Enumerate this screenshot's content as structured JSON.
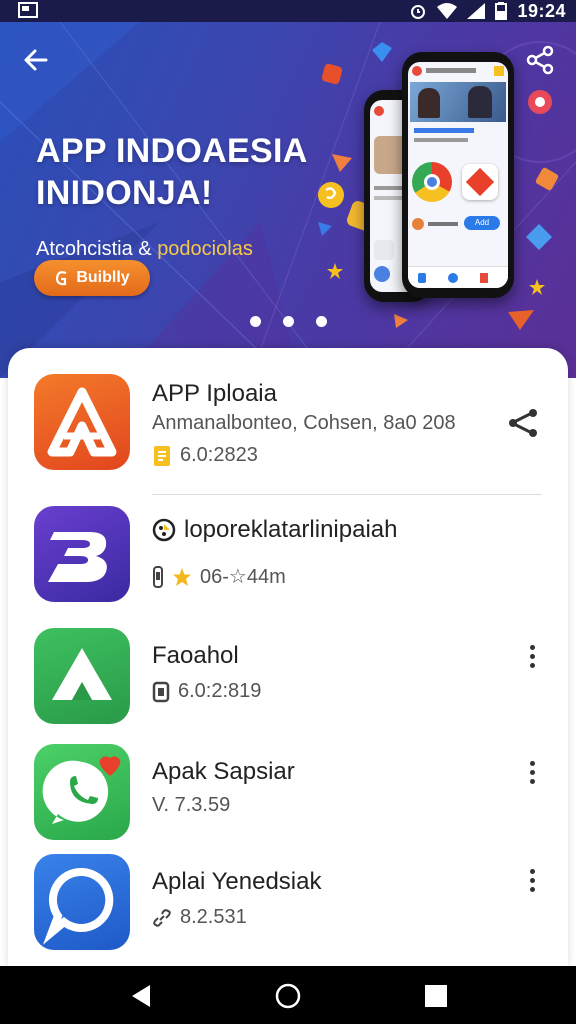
{
  "status_bar": {
    "time": "19:24",
    "icons": [
      "alarm-icon",
      "wifi-icon",
      "cellular-icon",
      "battery-icon"
    ]
  },
  "hero": {
    "title_line1": "APP INDOAESIA",
    "title_line2": "INIDONJA!",
    "subtitle_a": "Atcohcistia",
    "subtitle_amp": "&",
    "subtitle_b": "podociolas",
    "cta_label": "Buiblly",
    "dots": 3,
    "phone_button": "Add"
  },
  "apps": [
    {
      "name": "APP Iploaia",
      "meta": "Anmanalbonteo, Cohsen, 8a0 208",
      "version": "6.0:2823",
      "icon_color": "#ec5a24",
      "action": "share"
    },
    {
      "name": "loporeklatarlinipaiah",
      "meta": "06-☆44m",
      "version": "",
      "icon_color": "#4a3ab0",
      "action": "none"
    },
    {
      "name": "Faoahol",
      "meta": "",
      "version": "6.0:2:819",
      "icon_color": "#34a853",
      "action": "more"
    },
    {
      "name": "Apak Sapsiar",
      "meta": "",
      "version": "V. 7.3.59",
      "icon_color": "#3cbc5c",
      "action": "more"
    },
    {
      "name": "Aplai Yenedsiak",
      "meta": "",
      "version": "8.2.531",
      "icon_color": "#2a6ee0",
      "action": "more"
    }
  ],
  "colors": {
    "status_bar": "#1a1b4a",
    "hero_start": "#2a4fb8",
    "hero_end": "#5a2f96",
    "accent_orange": "#f0842a",
    "nav_bar": "#000000"
  }
}
